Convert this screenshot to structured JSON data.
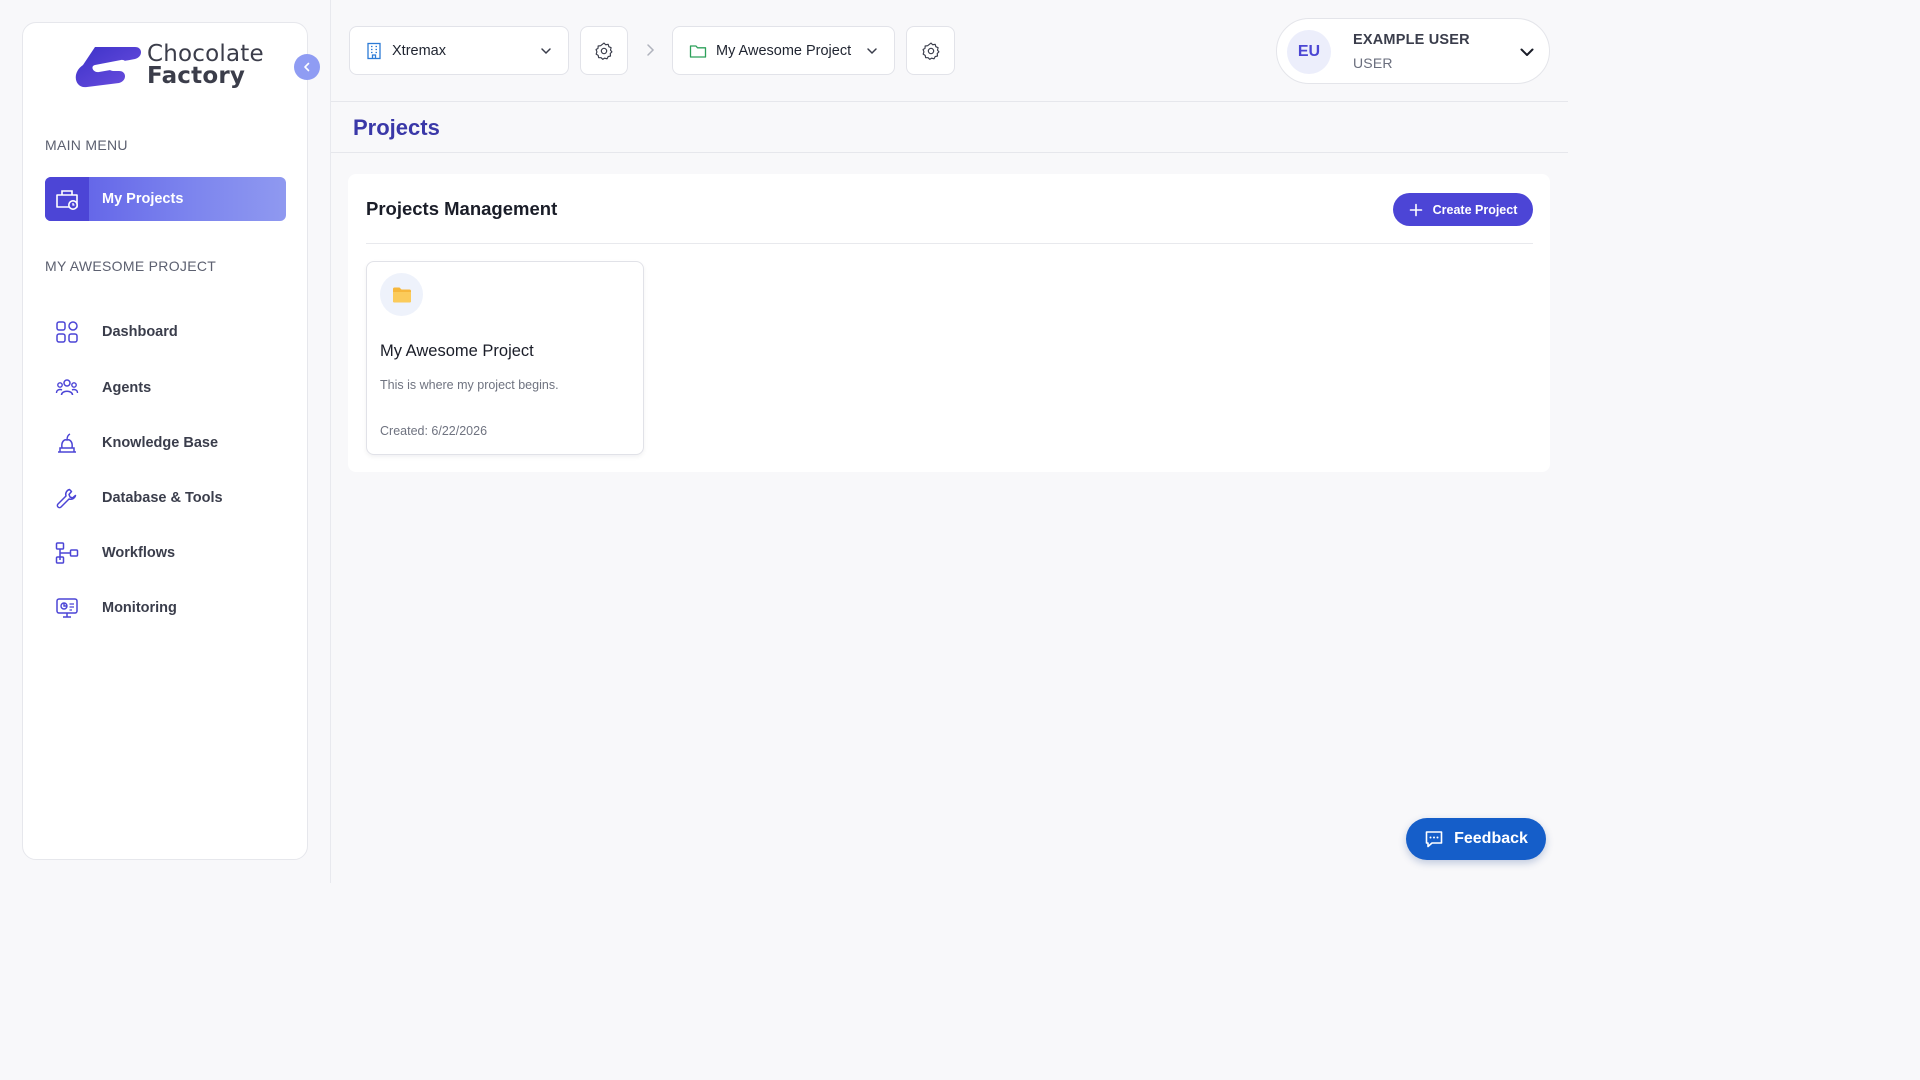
{
  "app": {
    "logo_line1": "Chocolate",
    "logo_line2": "Factory"
  },
  "sidebar": {
    "main_menu_title": "MAIN MENU",
    "active_item": {
      "label": "My Projects",
      "icon": "projects-icon"
    },
    "project_section_title": "MY AWESOME PROJECT",
    "items": [
      {
        "label": "Dashboard",
        "icon": "dashboard-icon"
      },
      {
        "label": "Agents",
        "icon": "agents-icon"
      },
      {
        "label": "Knowledge Base",
        "icon": "knowledge-base-icon"
      },
      {
        "label": "Database & Tools",
        "icon": "wrench-icon"
      },
      {
        "label": "Workflows",
        "icon": "workflow-icon"
      },
      {
        "label": "Monitoring",
        "icon": "monitor-icon"
      }
    ]
  },
  "topbar": {
    "organization": "Xtremax",
    "project": "My Awesome Project",
    "user": {
      "initials": "EU",
      "name": "EXAMPLE USER",
      "role": "USER"
    }
  },
  "page": {
    "title": "Projects",
    "panel_title": "Projects Management",
    "create_button": "Create Project"
  },
  "projects": [
    {
      "name": "My Awesome Project",
      "description": "This is where my project begins.",
      "created": "Created: 6/22/2026"
    }
  ],
  "feedback_label": "Feedback",
  "colors": {
    "accent": "#4c45d6",
    "title": "#3a38a8",
    "feedback": "#155ec9"
  }
}
